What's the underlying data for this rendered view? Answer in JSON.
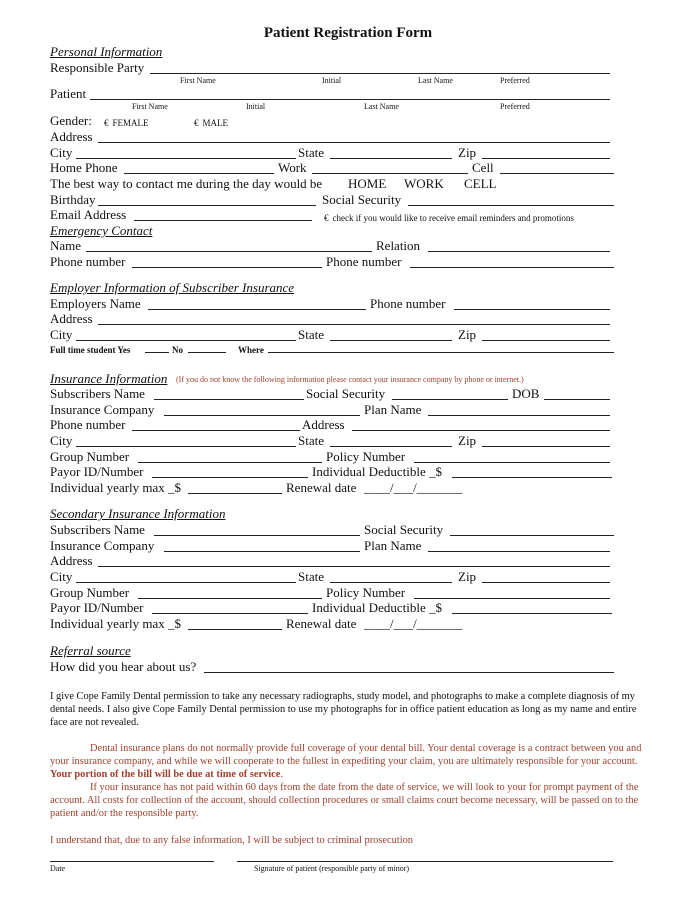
{
  "title": "Patient Registration Form",
  "personal": {
    "heading": "Personal Information",
    "responsible_party": "Responsible Party",
    "patient": "Patient",
    "name_parts": [
      "First Name",
      "Initial",
      "Last Name",
      "Preferred"
    ],
    "gender_label": "Gender:",
    "gender_options": [
      "FEMALE",
      "MALE"
    ],
    "checkbox_glyph": "€",
    "address": "Address",
    "city": "City",
    "state": "State",
    "zip": "Zip",
    "home_phone": "Home Phone",
    "work": "Work",
    "cell": "Cell",
    "contact_pref": "The best way to contact me during the day would be",
    "contact_options": [
      "HOME",
      "WORK",
      "CELL"
    ],
    "birthday": "Birthday",
    "social_security": "Social Security",
    "email": "Email Address",
    "email_opt_in": "check if you would like to receive email reminders and promotions"
  },
  "emergency": {
    "heading": "Emergency Contact",
    "name": "Name",
    "relation": "Relation",
    "phone1": "Phone number",
    "phone2": "Phone number"
  },
  "employer": {
    "heading": "Employer Information of Subscriber Insurance",
    "employers_name": "Employers Name",
    "phone": "Phone number",
    "address": "Address",
    "city": "City",
    "state": "State",
    "zip": "Zip",
    "student": "Full time student Yes",
    "no": "No",
    "where": "Where"
  },
  "insurance": {
    "heading": "Insurance Information",
    "note": "(If you do not know the following information please contact your insurance company by phone or internet.)",
    "subscribers_name": "Subscribers Name",
    "social_security": "Social Security",
    "dob": "DOB",
    "company": "Insurance Company",
    "plan": "Plan Name",
    "phone": "Phone number",
    "address": "Address",
    "city": "City",
    "state": "State",
    "zip": "Zip",
    "group": "Group Number",
    "policy": "Policy Number",
    "payor": "Payor ID/Number",
    "deductible": "Individual Deductible _$",
    "yearly_max": "Individual yearly max _$",
    "renewal": "Renewal date",
    "renewal_blank": "____/___/_______"
  },
  "secondary": {
    "heading": "Secondary Insurance Information",
    "subscribers_name": "Subscribers Name",
    "social_security": "Social Security",
    "company": "Insurance Company",
    "plan": "Plan Name",
    "address": "Address",
    "city": "City",
    "state": "State",
    "zip": "Zip",
    "group": "Group Number",
    "policy": "Policy Number",
    "payor": "Payor ID/Number",
    "deductible": "Individual Deductible _$",
    "yearly_max": "Individual yearly max _$",
    "renewal": "Renewal date",
    "renewal_blank": "____/___/_______"
  },
  "referral": {
    "heading": "Referral source",
    "question": "How did you hear about us?"
  },
  "consent": "I give Cope Family Dental permission to take any necessary radiographs, study model, and photographs to make a complete diagnosis of my dental needs.  I also give Cope Family Dental permission to use my photographs for in office patient education as long as my name and entire face are not revealed.",
  "insurance_policy": {
    "p1": "Dental insurance plans do not normally provide full coverage of your dental bill.  Your dental coverage is a contract between you and your insurance company, and while we will cooperate to the fullest in expediting your claim, you are ultimately responsible for your account. ",
    "p1_bold": "Your portion of the bill will be due at time of service",
    "p1_end": ".",
    "p2": "If your insurance has not paid within 60 days from the date from the date of service, we will look to your for prompt payment of the account. All costs for collection of the account, should collection procedures or small claims court become necessary, will be passed on to the patient and/or the responsible party."
  },
  "false_info": "I understand that, due to any false information, I will be subject to criminal prosecution",
  "signature": {
    "date": "Date",
    "signature": "Signature of patient (responsible party of minor)"
  },
  "colors": {
    "note_red": "#a0412d"
  }
}
